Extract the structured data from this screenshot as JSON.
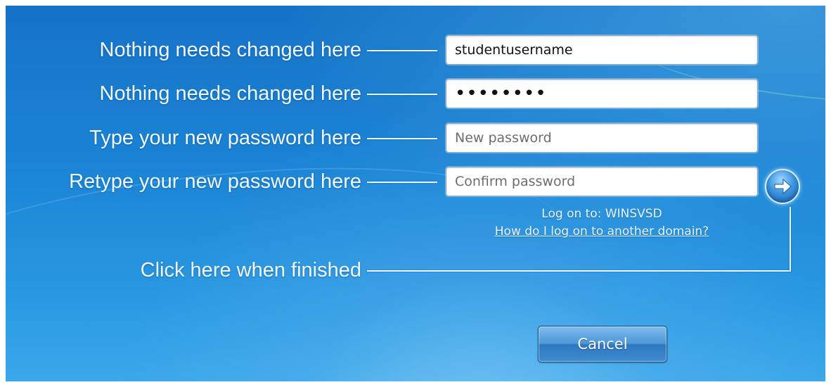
{
  "labels": {
    "username": "Nothing needs changed here",
    "old_password": "Nothing needs changed here",
    "new_password": "Type your new password here",
    "confirm_password": "Retype your new password here",
    "submit": "Click here when finished"
  },
  "fields": {
    "username": {
      "value": "studentusername"
    },
    "old_password": {
      "value": "••••••••"
    },
    "new_password": {
      "placeholder": "New password"
    },
    "confirm_password": {
      "placeholder": "Confirm password"
    }
  },
  "domain": {
    "log_on_to": "Log on to: WINSVSD",
    "other_domain_link": "How do I log on to another domain?"
  },
  "buttons": {
    "cancel": "Cancel",
    "submit_icon": "right-arrow-icon"
  },
  "colors": {
    "background": "#1b85d6",
    "annotation_text": "#f2f8ff",
    "button_blue": "#3c95de"
  }
}
